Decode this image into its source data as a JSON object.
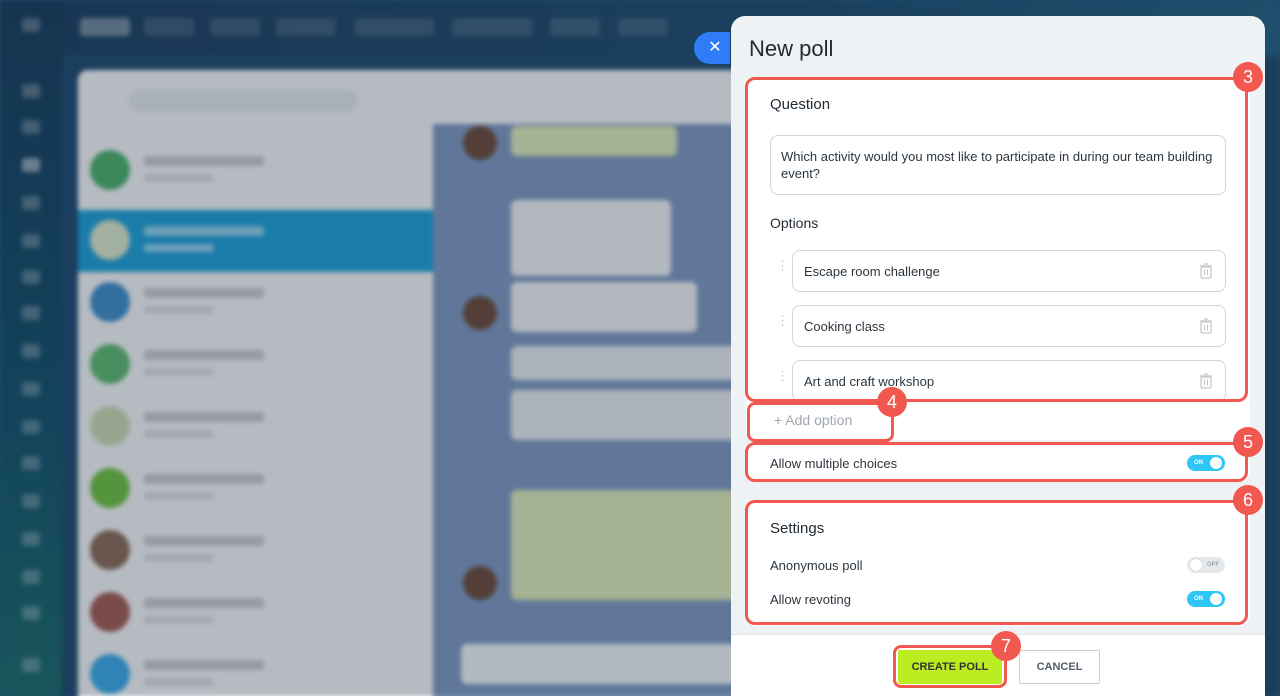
{
  "panel": {
    "title": "New poll",
    "close_icon": "✕"
  },
  "question": {
    "label": "Question",
    "value": "Which activity would you most like to participate in during our team building event?"
  },
  "options": {
    "label": "Options",
    "items": [
      {
        "text": "Escape room challenge"
      },
      {
        "text": "Cooking class"
      },
      {
        "text": "Art and craft workshop"
      }
    ],
    "add_label": "+ Add option"
  },
  "multi": {
    "label": "Allow multiple choices",
    "state": "ON"
  },
  "settings": {
    "heading": "Settings",
    "anonymous": {
      "label": "Anonymous poll",
      "state": "OFF"
    },
    "revoting": {
      "label": "Allow revoting",
      "state": "ON"
    }
  },
  "footer": {
    "create_label": "CREATE POLL",
    "cancel_label": "CANCEL"
  },
  "annotations": {
    "badge_3": "3",
    "badge_4": "4",
    "badge_5": "5",
    "badge_6": "6",
    "badge_7": "7",
    "color": "#f1584f"
  },
  "colors": {
    "toggle_on": "#2fc6f6",
    "create_button": "#bbed21",
    "close_button": "#2f7df6"
  }
}
